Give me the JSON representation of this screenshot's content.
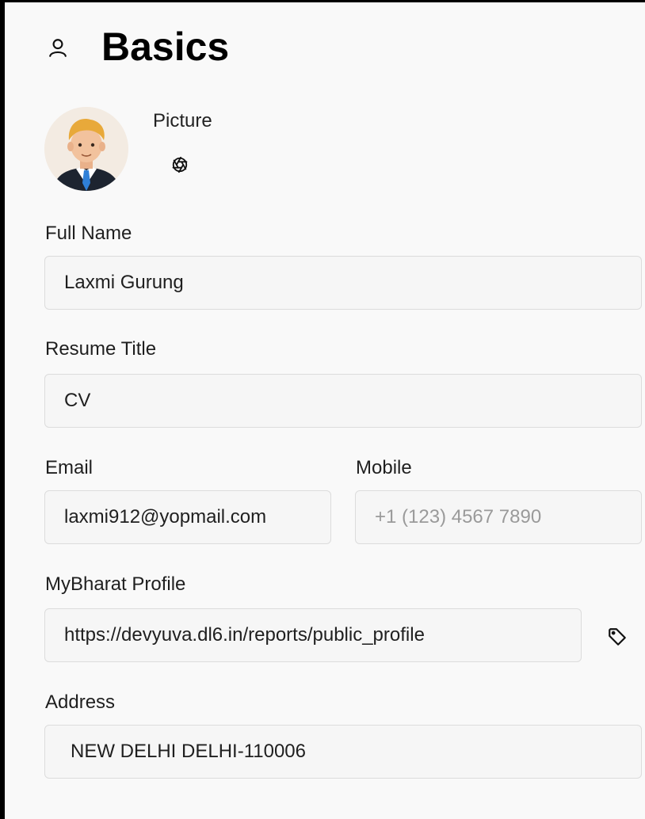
{
  "header": {
    "title": "Basics",
    "icon": "user-icon"
  },
  "picture": {
    "label": "Picture",
    "avatar": "avatar-illustration",
    "action_icon": "aperture-icon"
  },
  "fields": {
    "full_name": {
      "label": "Full Name",
      "value": "Laxmi Gurung"
    },
    "resume_title": {
      "label": "Resume Title",
      "value": "CV"
    },
    "email": {
      "label": "Email",
      "value": "laxmi912@yopmail.com"
    },
    "mobile": {
      "label": "Mobile",
      "value": "",
      "placeholder": "+1 (123) 4567 7890"
    },
    "mybharat_profile": {
      "label": "MyBharat Profile",
      "value": "https://devyuva.dl6.in/reports/public_profile",
      "action_icon": "tag-icon"
    },
    "address": {
      "label": "Address",
      "value": "NEW DELHI DELHI-110006"
    }
  },
  "colors": {
    "page_background": "#f9f9f9",
    "field_background": "#f6f6f6",
    "field_border": "#dcdcdc",
    "placeholder_text": "#9a9a9a"
  }
}
